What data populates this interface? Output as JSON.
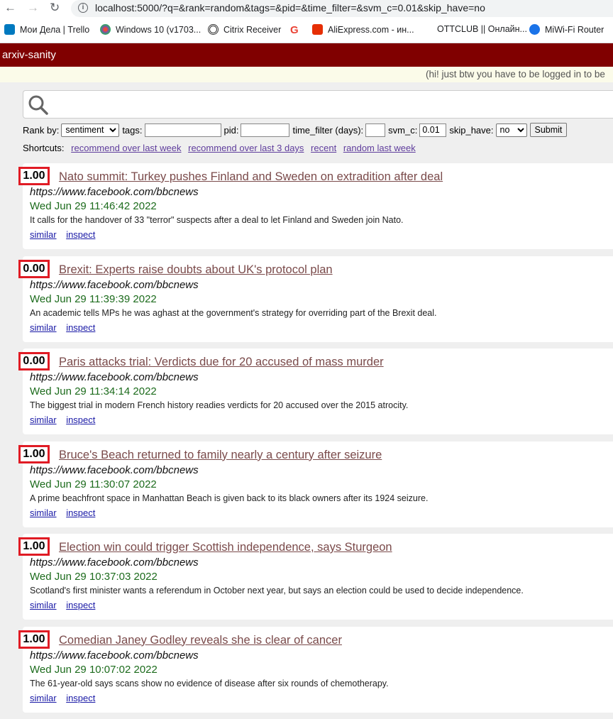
{
  "browser": {
    "url": "localhost:5000/?q=&rank=random&tags=&pid=&time_filter=&svm_c=0.01&skip_have=no",
    "bookmarks": [
      {
        "label": "Мои Дела | Trello",
        "icon": "trello-icon",
        "color": "#0079bf"
      },
      {
        "label": "Windows 10 (v1703...",
        "icon": "windows-flower-icon",
        "color": "#8e44ad"
      },
      {
        "label": "Citrix Receiver",
        "icon": "citrix-icon",
        "color": "#333333"
      },
      {
        "label": "",
        "icon": "google-icon",
        "color": "#ea4335"
      },
      {
        "label": "AliExpress.com - ин...",
        "icon": "aliexpress-icon",
        "color": "#e62e04"
      },
      {
        "label": "OTTCLUB || Онлайн...",
        "icon": "",
        "color": ""
      },
      {
        "label": "MiWi-Fi Router",
        "icon": "wifi-icon",
        "color": "#1a73e8"
      }
    ]
  },
  "header": {
    "brand": "arxiv-sanity",
    "notice": "(hi! just btw you have to be logged in to be"
  },
  "search": {
    "placeholder": "",
    "rank_label": "Rank by:",
    "rank_value": "sentiment",
    "tags_label": "tags:",
    "tags_value": "",
    "pid_label": "pid:",
    "pid_value": "",
    "time_filter_label": "time_filter (days):",
    "time_filter_value": "",
    "svm_c_label": "svm_c:",
    "svm_c_value": "0.01",
    "skip_have_label": "skip_have:",
    "skip_have_value": "no",
    "submit_label": "Submit"
  },
  "shortcuts": {
    "label": "Shortcuts:",
    "links": [
      "recommend over last week",
      "recommend over last 3 days",
      "recent",
      "random last week"
    ]
  },
  "colors": {
    "header_bg": "#800000",
    "score_border": "#e01b24",
    "title_link": "#7a4a4a",
    "time": "#1c6b1c"
  },
  "papers": [
    {
      "score": "1.00",
      "title": "Nato summit: Turkey pushes Finland and Sweden on extradition after deal",
      "author": "https://www.facebook.com/bbcnews",
      "time": "Wed Jun 29 11:46:42 2022",
      "summary": "It calls for the handover of 33 \"terror\" suspects after a deal to let Finland and Sweden join Nato.",
      "similar": "similar",
      "inspect": "inspect"
    },
    {
      "score": "0.00",
      "title": "Brexit: Experts raise doubts about UK's protocol plan",
      "author": "https://www.facebook.com/bbcnews",
      "time": "Wed Jun 29 11:39:39 2022",
      "summary": "An academic tells MPs he was aghast at the government's strategy for overriding part of the Brexit deal.",
      "similar": "similar",
      "inspect": "inspect"
    },
    {
      "score": "0.00",
      "title": "Paris attacks trial: Verdicts due for 20 accused of mass murder",
      "author": "https://www.facebook.com/bbcnews",
      "time": "Wed Jun 29 11:34:14 2022",
      "summary": "The biggest trial in modern French history readies verdicts for 20 accused over the 2015 atrocity.",
      "similar": "similar",
      "inspect": "inspect"
    },
    {
      "score": "1.00",
      "title": "Bruce's Beach returned to family nearly a century after seizure",
      "author": "https://www.facebook.com/bbcnews",
      "time": "Wed Jun 29 11:30:07 2022",
      "summary": "A prime beachfront space in Manhattan Beach is given back to its black owners after its 1924 seizure.",
      "similar": "similar",
      "inspect": "inspect"
    },
    {
      "score": "1.00",
      "title": "Election win could trigger Scottish independence, says Sturgeon",
      "author": "https://www.facebook.com/bbcnews",
      "time": "Wed Jun 29 10:37:03 2022",
      "summary": "Scotland's first minister wants a referendum in October next year, but says an election could be used to decide independence.",
      "similar": "similar",
      "inspect": "inspect"
    },
    {
      "score": "1.00",
      "title": "Comedian Janey Godley reveals she is clear of cancer",
      "author": "https://www.facebook.com/bbcnews",
      "time": "Wed Jun 29 10:07:02 2022",
      "summary": "The 61-year-old says scans show no evidence of disease after six rounds of chemotherapy.",
      "similar": "similar",
      "inspect": "inspect"
    }
  ]
}
